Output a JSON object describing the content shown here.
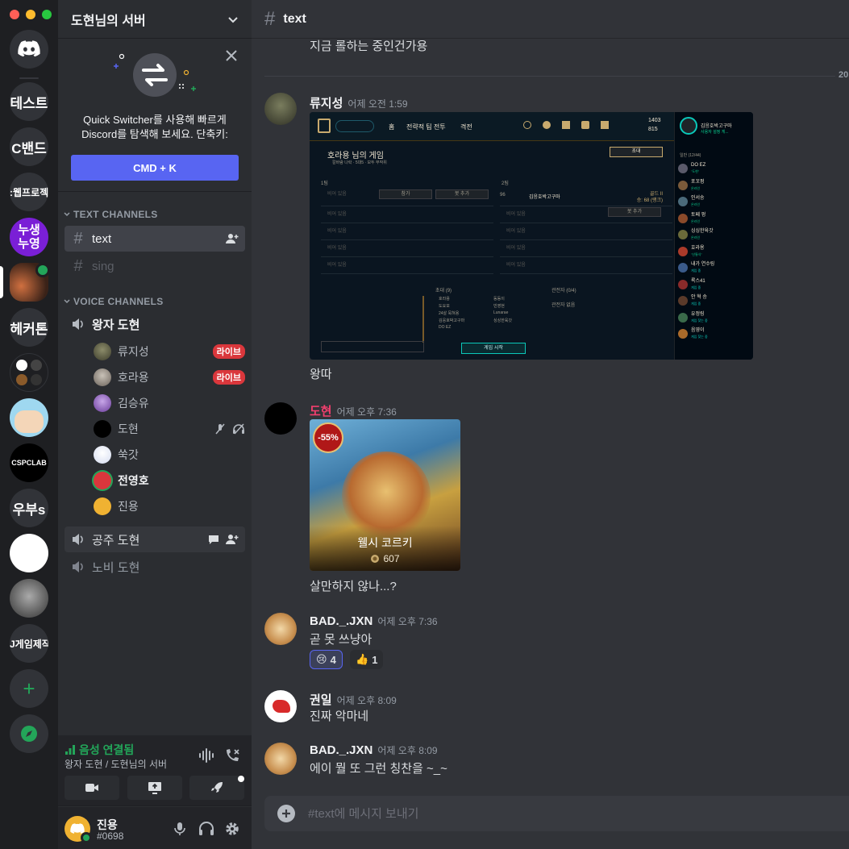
{
  "servers": [
    {
      "label": "테스트"
    },
    {
      "label": "C밴드"
    },
    {
      "label": ":웹프로젝트"
    },
    {
      "label": "누생\n누영"
    },
    {
      "label": "헤커톤"
    },
    {
      "label": "우부s"
    },
    {
      "label": "J게임제작"
    }
  ],
  "server_name": "도현님의 서버",
  "quick_switcher": {
    "text_line1": "Quick Switcher를 사용해 빠르게",
    "text_line2": "Discord를 탐색해 보세요. 단축키:",
    "button": "CMD + K"
  },
  "text_category": "TEXT CHANNELS",
  "text_channels": [
    {
      "name": "text"
    },
    {
      "name": "sing"
    }
  ],
  "voice_category": "VOICE CHANNELS",
  "voice_channels": [
    {
      "name": "왕자 도현"
    },
    {
      "name": "공주 도현"
    },
    {
      "name": "노비 도현"
    }
  ],
  "voice_users": [
    {
      "name": "류지성",
      "badge": "라이브"
    },
    {
      "name": "호라용",
      "badge": "라이브"
    },
    {
      "name": "김승유"
    },
    {
      "name": "도현"
    },
    {
      "name": "쑥갓"
    },
    {
      "name": "전영호"
    },
    {
      "name": "진용"
    }
  ],
  "voice_status": {
    "title": "음성 연결됨",
    "sub": "왕자 도현 / 도현님의 서버"
  },
  "user": {
    "name": "진용",
    "tag": "#0698"
  },
  "chat": {
    "channel": "text",
    "prev_text": "지금 롤하는 중인건가용",
    "divider_date": "20",
    "composer_placeholder": "#text에 메시지 보내기",
    "messages": [
      {
        "author": "류지성",
        "time": "어제 오전 1:59",
        "text": "왕따"
      },
      {
        "author": "도현",
        "time": "어제 오후 7:36",
        "text": "살만하지 않나...?",
        "card_title": "웰시 코르키",
        "card_price": "607",
        "discount": "-55%"
      },
      {
        "author": "BAD._.JXN",
        "time": "어제 오후 7:36",
        "text": "곧 못 쓰냥아",
        "reactions": [
          {
            "emoji": "😢",
            "count": "4"
          },
          {
            "emoji": "👍",
            "count": "1"
          }
        ]
      },
      {
        "author": "권일",
        "time": "어제 오후 8:09",
        "text": "진짜 악마네"
      },
      {
        "author": "BAD._.JXN",
        "time": "어제 오후 8:09",
        "text": "에이 뭘 또 그런 칭찬을 ~_~"
      }
    ]
  },
  "game_lobby": {
    "nav": [
      "홈",
      "전략적 팀 전투",
      "격전"
    ],
    "rp": "1403",
    "be": "815",
    "summoner": "김응호박고구마",
    "status": "사용자 설정 게...",
    "title": "호라용 님의 게임",
    "subtitle": "칼바람 나락 · 5대5 · 모두 무작위",
    "invite_btn": "초대",
    "team1": "1팀",
    "team2": "2팀",
    "join_btn": "참가",
    "add_bot_btn": "봇 추가",
    "empty_slot": "비어 있음",
    "team2_player": "김응호박고구마",
    "team2_level": "96",
    "team2_rank": "골드 II",
    "team2_lp": "승: 68 (랭크)",
    "invited_header": "초대 (9)",
    "spectators_header": "관전자 (0/4)",
    "spectators_empty": "관전자 없음",
    "invited": [
      "호라용",
      "도요모",
      "24살 묵혀용",
      "김응호박고구마",
      "DO EZ",
      "동동이",
      "빈영현",
      "Lunarae",
      "싱싱한육갓"
    ],
    "start_btn": "게임 시작",
    "friends_header": "일반 (12/44)",
    "friends": [
      {
        "name": "DO EZ",
        "status": "\"도현\""
      },
      {
        "name": "포꼬펑",
        "status": "온라인"
      },
      {
        "name": "인서송",
        "status": "온라인"
      },
      {
        "name": "토페 펑",
        "status": "온라인"
      },
      {
        "name": "싱싱한육갓",
        "status": "온라인"
      },
      {
        "name": "호라용",
        "status": "\"산통식\""
      },
      {
        "name": "내가 연수링",
        "status": "게임 중"
      },
      {
        "name": "록스41",
        "status": "게임 중"
      },
      {
        "name": "안 혁 승",
        "status": "게임 중"
      },
      {
        "name": "유정링",
        "status": "게임 찾는 중"
      },
      {
        "name": "음영이",
        "status": "게임 찾는 중"
      }
    ]
  }
}
